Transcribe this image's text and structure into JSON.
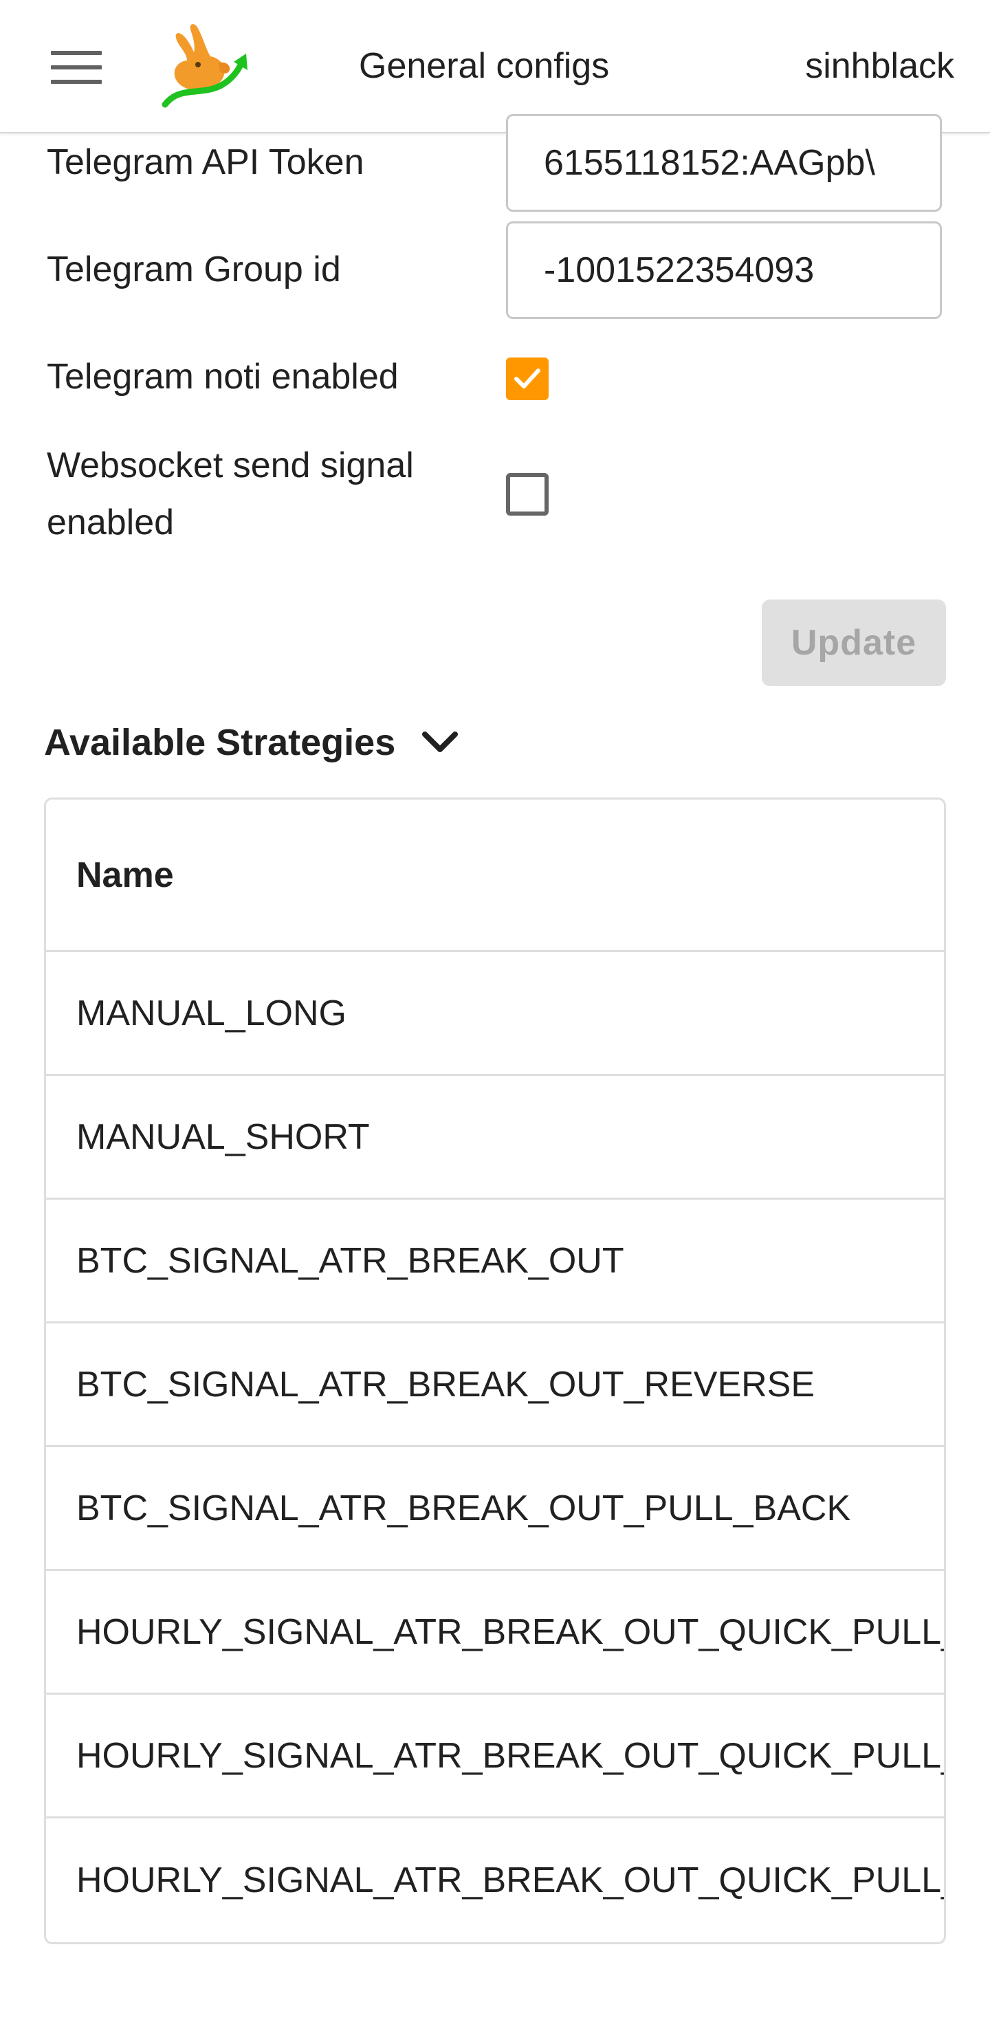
{
  "header": {
    "title": "General configs",
    "username": "sinhblack"
  },
  "form": {
    "telegram_api_token": {
      "label": "Telegram API Token",
      "value": "6155118152:AAGpb\\"
    },
    "telegram_group_id": {
      "label": "Telegram Group id",
      "value": "-1001522354093"
    },
    "telegram_noti_enabled": {
      "label": "Telegram noti enabled",
      "checked": true
    },
    "websocket_send_signal_enabled": {
      "label_line1": "Websocket send signal",
      "label_line2": "enabled",
      "checked": false
    },
    "update_label": "Update"
  },
  "strategies": {
    "title": "Available Strategies",
    "column_header": "Name",
    "rows": [
      "MANUAL_LONG",
      "MANUAL_SHORT",
      "BTC_SIGNAL_ATR_BREAK_OUT",
      "BTC_SIGNAL_ATR_BREAK_OUT_REVERSE",
      "BTC_SIGNAL_ATR_BREAK_OUT_PULL_BACK",
      "HOURLY_SIGNAL_ATR_BREAK_OUT_QUICK_PULL_",
      "HOURLY_SIGNAL_ATR_BREAK_OUT_QUICK_PULL_",
      "HOURLY_SIGNAL_ATR_BREAK_OUT_QUICK_PULL_"
    ]
  },
  "colors": {
    "accent": "#ff9800",
    "disabled_button": "#e0e0e0",
    "border": "#dedede"
  },
  "icons": {
    "menu": "hamburger-menu-icon",
    "logo": "rabbit-logo-icon",
    "collapse": "chevron-down-icon",
    "check": "checkmark-icon"
  }
}
